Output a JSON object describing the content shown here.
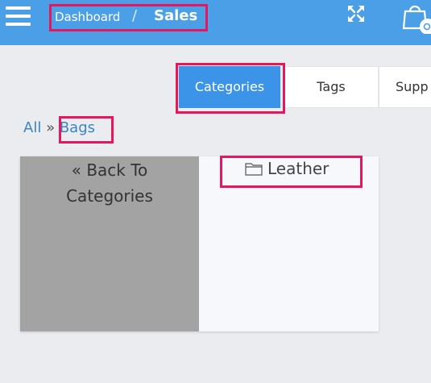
{
  "header": {
    "breadcrumb_home": "Dashboard",
    "breadcrumb_separator": "/",
    "breadcrumb_current": "Sales",
    "background_color": "#4a9fe6",
    "icons": [
      "menu-icon",
      "expand-icon",
      "shopping-bag-icon"
    ]
  },
  "tabs": [
    {
      "label": "Categories",
      "active": true
    },
    {
      "label": "Tags",
      "active": false
    },
    {
      "label": "Supp",
      "active": false
    }
  ],
  "path": {
    "root": "All",
    "separator": "»",
    "current": "Bags"
  },
  "grid": {
    "back_tile": {
      "arrow": "«",
      "line1": "Back To",
      "line2": "Categories"
    },
    "folders": [
      {
        "label": "Leather",
        "icon": "folder-icon"
      }
    ]
  },
  "colors": {
    "accent": "#3b94e8",
    "highlight": "#e8175d",
    "link": "#3b84c4"
  }
}
